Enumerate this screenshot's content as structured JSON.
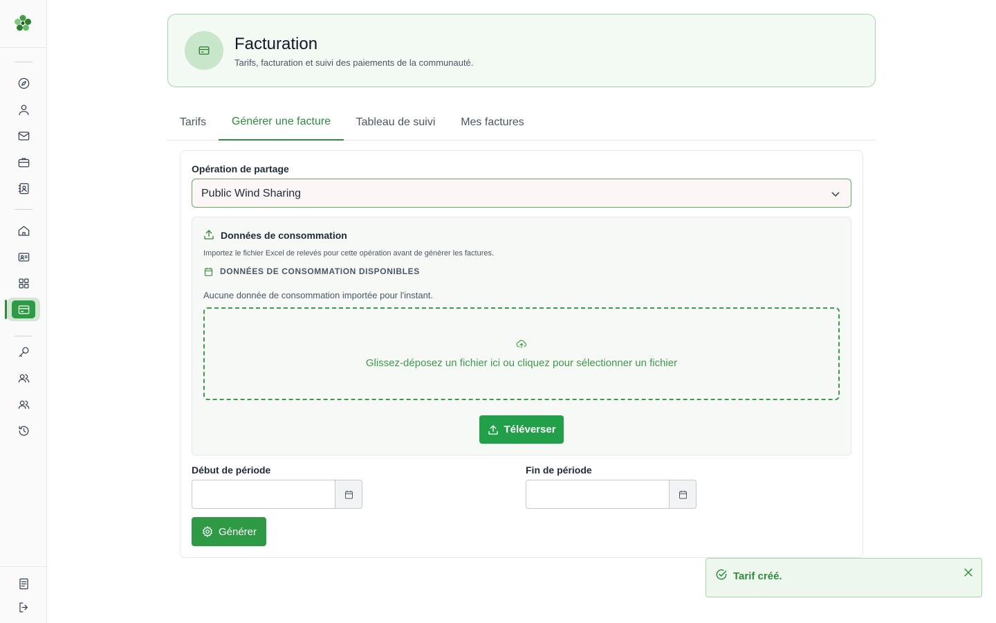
{
  "sidebar": {
    "logo": "clover-logo",
    "items": [
      {
        "icon": "compass-icon"
      },
      {
        "icon": "user-icon"
      },
      {
        "icon": "mail-icon"
      },
      {
        "icon": "briefcase-icon"
      },
      {
        "icon": "contact-book-icon"
      },
      {
        "icon": "home-icon"
      },
      {
        "icon": "id-card-icon"
      },
      {
        "icon": "grid-icon"
      },
      {
        "icon": "credit-card-icon",
        "active": true
      },
      {
        "icon": "key-icon"
      },
      {
        "icon": "users-icon"
      },
      {
        "icon": "users-group-icon"
      },
      {
        "icon": "history-icon"
      },
      {
        "icon": "document-icon"
      },
      {
        "icon": "logout-icon"
      }
    ]
  },
  "header": {
    "icon": "credit-card-icon",
    "title": "Facturation",
    "subtitle": "Tarifs, facturation et suivi des paiements de la communauté."
  },
  "tabs": [
    {
      "label": "Tarifs",
      "active": false
    },
    {
      "label": "Générer une facture",
      "active": true
    },
    {
      "label": "Tableau de suivi",
      "active": false
    },
    {
      "label": "Mes factures",
      "active": false
    }
  ],
  "form": {
    "operation_label": "Opération de partage",
    "operation_value": "Public Wind Sharing",
    "consumption": {
      "title": "Données de consommation",
      "description": "Importez le fichier Excel de relevés pour cette opération avant de générer les factures.",
      "available_label": "DONNÉES DE CONSOMMATION DISPONIBLES",
      "empty_text": "Aucune donnée de consommation importée pour l'instant.",
      "dropzone_text": "Glissez-déposez un fichier ici ou cliquez pour sélectionner un fichier",
      "upload_label": "Téléverser"
    },
    "start_label": "Début de période",
    "end_label": "Fin de période",
    "start_value": "",
    "end_value": "",
    "generate_label": "Générer"
  },
  "toast": {
    "message": "Tarif créé."
  },
  "colors": {
    "accent": "#2f9a45",
    "accent_dark": "#2f8a3f",
    "header_bg": "#f3f9f3",
    "toast_bg": "#edf7ee"
  }
}
